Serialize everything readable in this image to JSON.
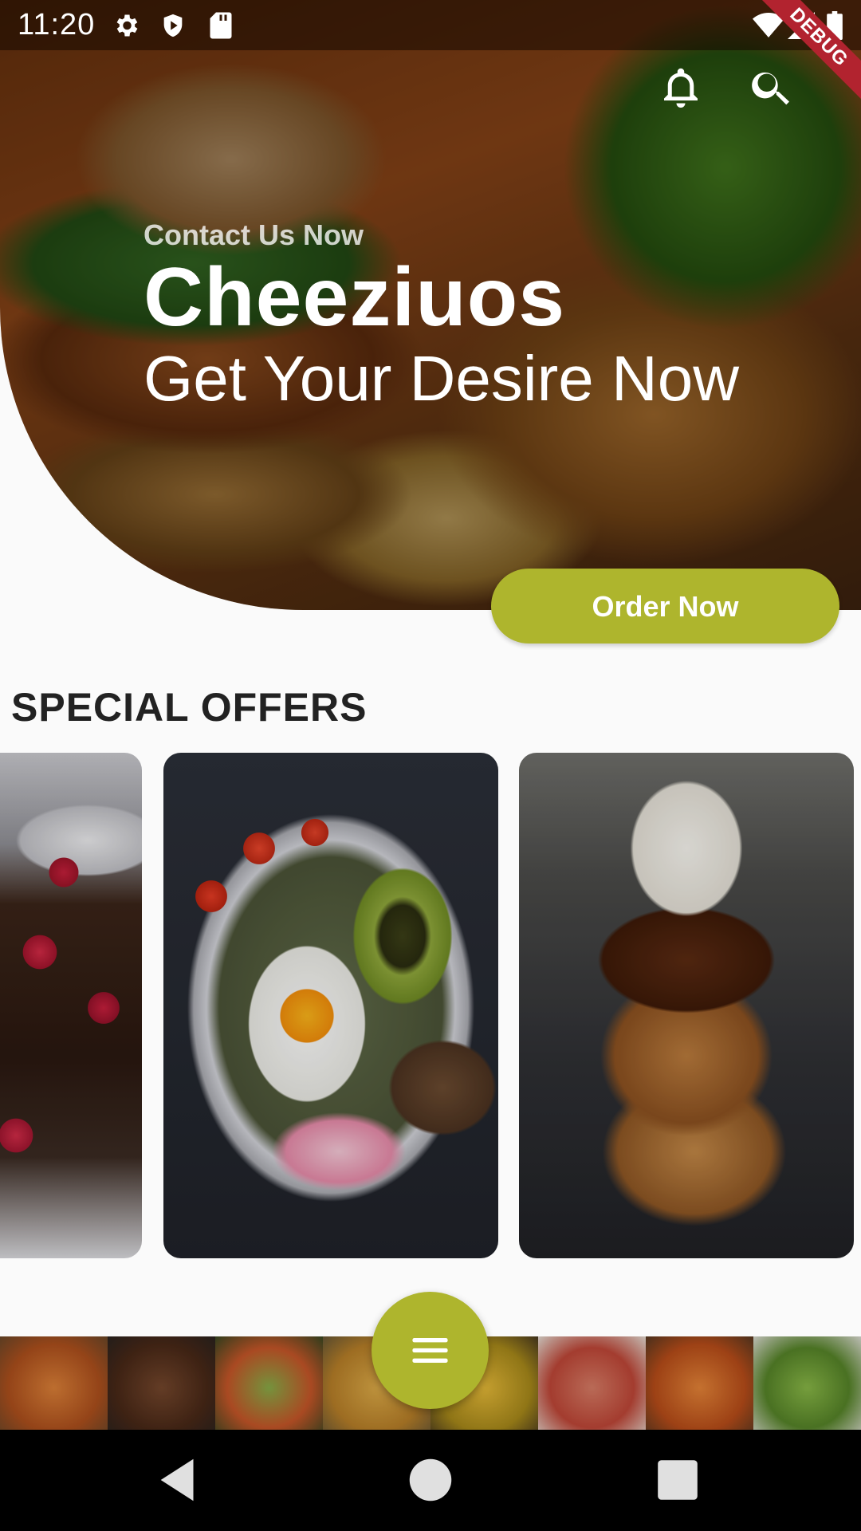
{
  "status_bar": {
    "time": "11:20",
    "icons": [
      "settings-icon",
      "shield-icon",
      "sd-card-icon",
      "wifi-icon",
      "signal-icon",
      "battery-icon"
    ],
    "debug_label": "DEBUG"
  },
  "app_bar": {
    "icons": [
      "notification-bell-icon",
      "search-icon"
    ]
  },
  "hero": {
    "subtitle": "Contact Us Now",
    "brand": "Cheeziuos",
    "tagline": "Get Your Desire Now"
  },
  "order_button": {
    "label": "Order Now"
  },
  "special_offers": {
    "title": "SPECIAL OFFERS",
    "cards": [
      {
        "image": "chocolate-cake-raspberries"
      },
      {
        "image": "egg-avocado-salad-bowl"
      },
      {
        "image": "waffle-ice-cream-chocolate"
      }
    ]
  },
  "bottom_strip": {
    "tiles": [
      "shrimp-pasta",
      "steak",
      "vegetables",
      "pasta",
      "nachos",
      "pizza",
      "shrimp",
      "salad"
    ]
  },
  "fab": {
    "icon": "menu-icon"
  },
  "nav_bar": {
    "icons": [
      "back-icon",
      "home-icon",
      "recents-icon"
    ]
  },
  "colors": {
    "accent": "#aeb52d",
    "debug": "#b2232f",
    "title": "#222222",
    "background": "#fafafa"
  }
}
